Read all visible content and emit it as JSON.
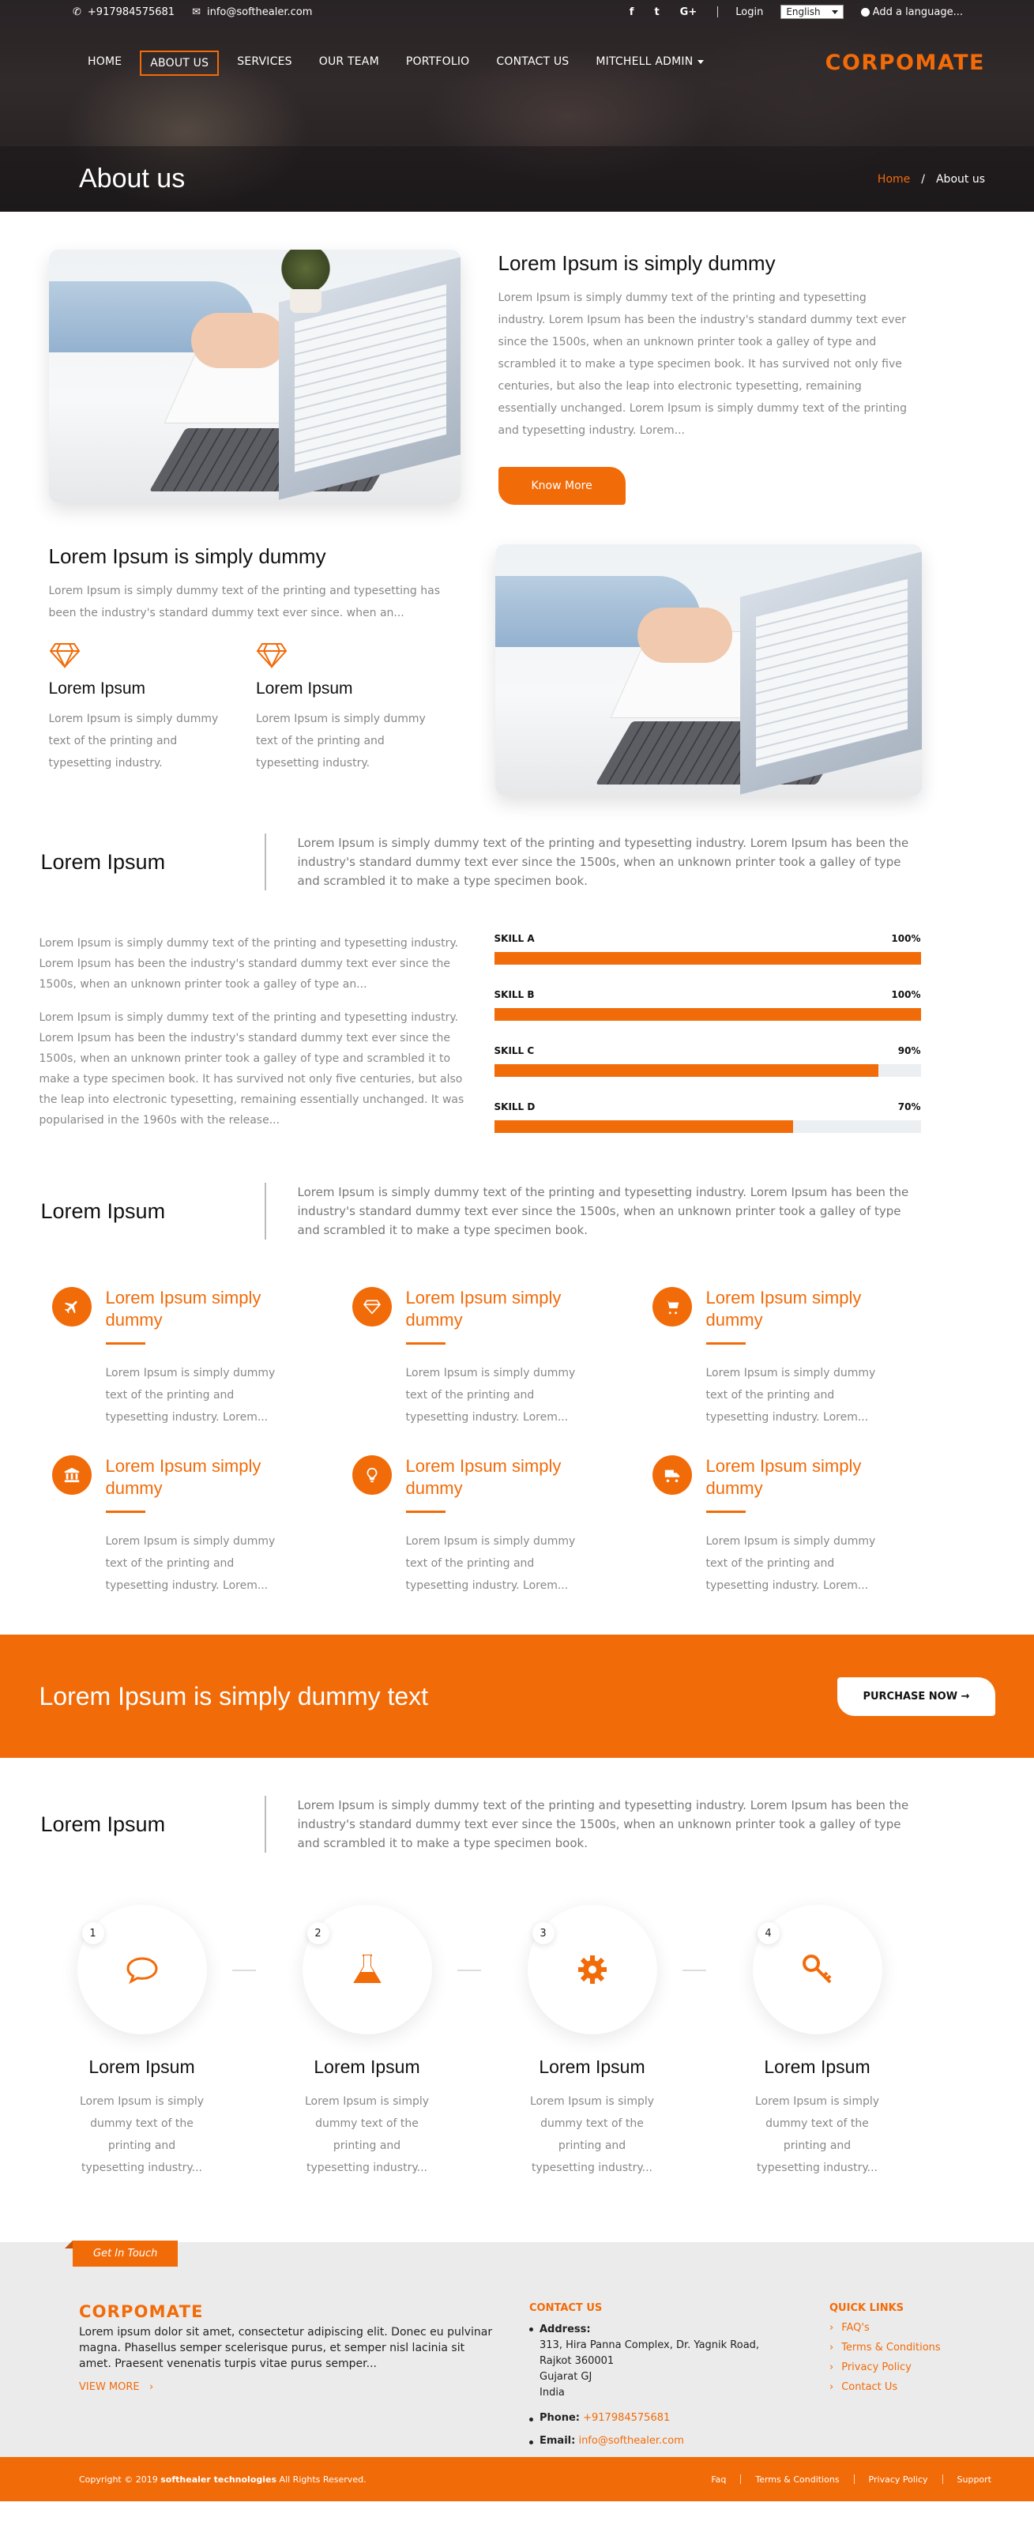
{
  "topbar": {
    "phone": "+917984575681",
    "email": "info@softhealer.com",
    "social": [
      "f",
      "t",
      "G+"
    ],
    "login": "Login",
    "language": "English",
    "add_language": "Add a language..."
  },
  "nav": {
    "items": [
      "HOME",
      "ABOUT US",
      "SERVICES",
      "OUR TEAM",
      "PORTFOLIO",
      "CONTACT US",
      "MITCHELL ADMIN"
    ],
    "active": "ABOUT US",
    "logo": "CORPOMATE"
  },
  "page": {
    "title": "About us",
    "breadcrumb_home": "Home",
    "breadcrumb_sep": "/",
    "breadcrumb_current": "About us"
  },
  "intro": {
    "title": "Lorem Ipsum is simply dummy",
    "body": "Lorem Ipsum is simply dummy text of the printing and typesetting industry. Lorem Ipsum has been the industry's standard dummy text ever since the 1500s, when an unknown printer took a galley of type and scrambled it to make a type specimen book. It has survived not only five centuries, but also the leap into electronic typesetting, remaining essentially unchanged. Lorem Ipsum is simply dummy text of the printing and typesetting industry. Lorem...",
    "button": "Know More"
  },
  "second": {
    "title": "Lorem Ipsum is simply dummy",
    "body": "Lorem Ipsum is simply dummy text of the printing and typesetting has been the industry's standard dummy text ever since. when an...",
    "cols": [
      {
        "title": "Lorem Ipsum",
        "body": "Lorem Ipsum is simply dummy text of the printing and typesetting industry."
      },
      {
        "title": "Lorem Ipsum",
        "body": "Lorem Ipsum is simply dummy text of the printing and typesetting industry."
      }
    ]
  },
  "lead1": {
    "title": "Lorem Ipsum",
    "body": "Lorem Ipsum is simply dummy text of the printing and typesetting industry. Lorem Ipsum has been the industry's standard dummy text ever since the 1500s, when an unknown printer took a galley of type and scrambled it to make a type specimen book."
  },
  "skills_text": {
    "p1": "Lorem Ipsum is simply dummy text of the printing and typesetting industry. Lorem Ipsum has been the industry's standard dummy text ever since the 1500s, when an unknown printer took a galley of type an...",
    "p2": "Lorem Ipsum is simply dummy text of the printing and typesetting industry. Lorem Ipsum has been the industry's standard dummy text ever since the 1500s, when an unknown printer took a galley of type and scrambled it to make a type specimen book. It has survived not only five centuries, but also the leap into electronic typesetting, remaining essentially unchanged. It was popularised in the 1960s with the release..."
  },
  "skills": [
    {
      "name": "SKILL A",
      "label": "100%",
      "value": 100
    },
    {
      "name": "SKILL B",
      "label": "100%",
      "value": 100
    },
    {
      "name": "SKILL C",
      "label": "90%",
      "value": 90
    },
    {
      "name": "SKILL D",
      "label": "70%",
      "value": 70
    }
  ],
  "lead2": {
    "title": "Lorem Ipsum",
    "body": "Lorem Ipsum is simply dummy text of the printing and typesetting industry. Lorem Ipsum has been the industry's standard dummy text ever since the 1500s, when an unknown printer took a galley of type and scrambled it to make a type specimen book."
  },
  "features": [
    {
      "icon": "plane-icon",
      "title": "Lorem Ipsum simply dummy",
      "body": "Lorem Ipsum is simply dummy text of the printing and typesetting industry. Lorem..."
    },
    {
      "icon": "diamond-icon",
      "title": "Lorem Ipsum simply dummy",
      "body": "Lorem Ipsum is simply dummy text of the printing and typesetting industry. Lorem..."
    },
    {
      "icon": "cart-icon",
      "title": "Lorem Ipsum simply dummy",
      "body": "Lorem Ipsum is simply dummy text of the printing and typesetting industry. Lorem..."
    },
    {
      "icon": "bank-icon",
      "title": "Lorem Ipsum simply dummy",
      "body": "Lorem Ipsum is simply dummy text of the printing and typesetting industry. Lorem..."
    },
    {
      "icon": "bulb-icon",
      "title": "Lorem Ipsum simply dummy",
      "body": "Lorem Ipsum is simply dummy text of the printing and typesetting industry. Lorem..."
    },
    {
      "icon": "truck-icon",
      "title": "Lorem Ipsum simply dummy",
      "body": "Lorem Ipsum is simply dummy text of the printing and typesetting industry. Lorem..."
    }
  ],
  "cta": {
    "title": "Lorem Ipsum is simply dummy text",
    "button": "PURCHASE NOW →"
  },
  "lead3": {
    "title": "Lorem Ipsum",
    "body": "Lorem Ipsum is simply dummy text of the printing and typesetting industry. Lorem Ipsum has been the industry's standard dummy text ever since the 1500s, when an unknown printer took a galley of type and scrambled it to make a type specimen book."
  },
  "steps": [
    {
      "num": "1",
      "icon": "chat-icon",
      "title": "Lorem Ipsum",
      "body": "Lorem Ipsum is simply dummy text of the printing and typesetting industry..."
    },
    {
      "num": "2",
      "icon": "flask-icon",
      "title": "Lorem Ipsum",
      "body": "Lorem Ipsum is simply dummy text of the printing and typesetting industry..."
    },
    {
      "num": "3",
      "icon": "gear-icon",
      "title": "Lorem Ipsum",
      "body": "Lorem Ipsum is simply dummy text of the printing and typesetting industry..."
    },
    {
      "num": "4",
      "icon": "key-icon",
      "title": "Lorem Ipsum",
      "body": "Lorem Ipsum is simply dummy text of the printing and typesetting industry..."
    }
  ],
  "footer": {
    "tag": "Get In Touch",
    "brand": "CORPOMATE",
    "about": "Lorem ipsum dolor sit amet, consectetur adipiscing elit. Donec eu pulvinar magna. Phasellus semper scelerisque purus, et semper nisl lacinia sit amet. Praesent venenatis turpis vitae purus semper...",
    "view_more": "VIEW MORE",
    "contact_heading": "CONTACT US",
    "address_label": "Address:",
    "address_lines": [
      "313, Hira Panna Complex, Dr. Yagnik Road,",
      "Rajkot 360001",
      "Gujarat GJ",
      "India"
    ],
    "phone_label": "Phone:",
    "phone": "+917984575681",
    "email_label": "Email:",
    "email": "info@softhealer.com",
    "links_heading": "QUICK LINKS",
    "links": [
      "FAQ's",
      "Terms & Conditions",
      "Privacy Policy",
      "Contact Us"
    ],
    "copyright_prefix": "Copyright © 2019",
    "copyright_company": "softhealer technologies",
    "copyright_suffix": "All Rights Reserved.",
    "bottom_links": [
      "Faq",
      "Terms & Conditions",
      "Privacy Policy",
      "Support"
    ]
  },
  "colors": {
    "accent": "#f26b09"
  }
}
